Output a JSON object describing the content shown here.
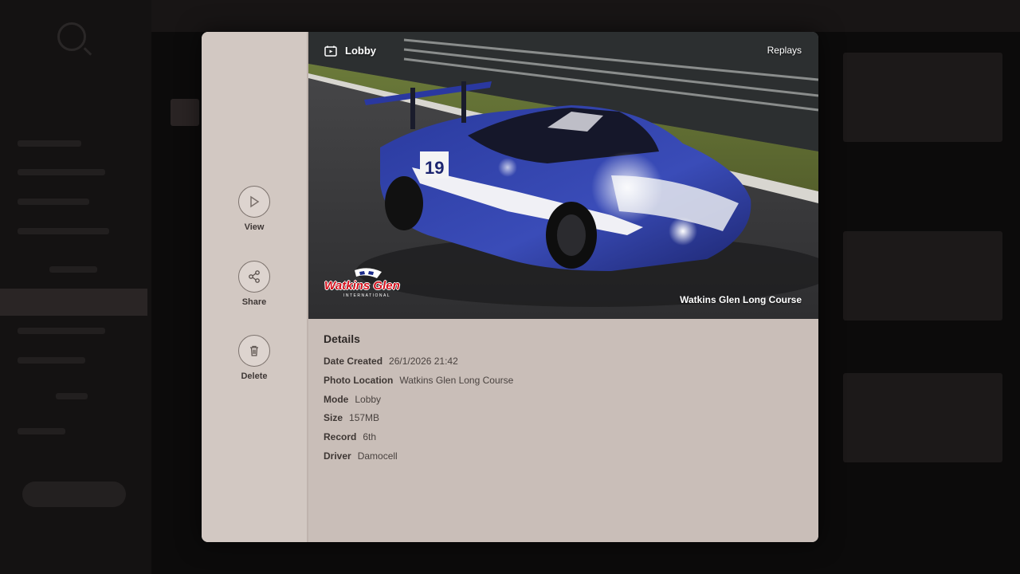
{
  "modal": {
    "actions": [
      {
        "label": "View",
        "icon": "play-icon"
      },
      {
        "label": "Share",
        "icon": "share-icon"
      },
      {
        "label": "Delete",
        "icon": "trash-icon"
      }
    ],
    "photo": {
      "mode_label": "Lobby",
      "replays_label": "Replays",
      "track_name": "Watkins Glen Long Course",
      "logo_text": "Watkins Glen",
      "logo_subtext": "INTERNATIONAL",
      "car_number": "19"
    },
    "details": {
      "title": "Details",
      "rows": [
        {
          "key": "Date Created",
          "value": "26/1/2026 21:42"
        },
        {
          "key": "Photo Location",
          "value": "Watkins Glen Long Course"
        },
        {
          "key": "Mode",
          "value": "Lobby"
        },
        {
          "key": "Size",
          "value": "157MB"
        },
        {
          "key": "Record",
          "value": "6th"
        },
        {
          "key": "Driver",
          "value": "Damocell"
        }
      ]
    }
  },
  "colors": {
    "modal_bg": "#c8bdb6",
    "sidebar_bg": "#d2c8c2",
    "car_blue": "#2d3fa8",
    "logo_red": "#d4101c"
  }
}
